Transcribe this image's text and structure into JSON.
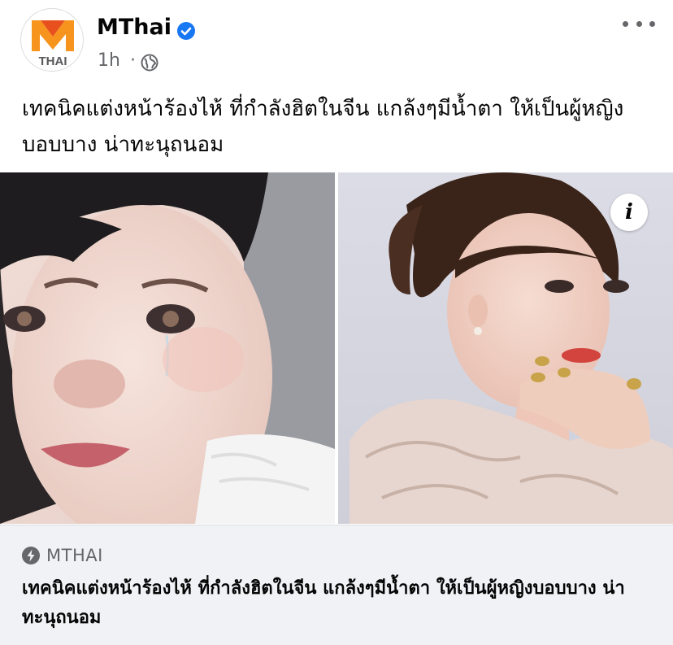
{
  "post": {
    "page_name": "MThai",
    "timestamp": "1h",
    "separator": "·",
    "caption": "เทคนิคแต่งหน้าร้องไห้ ที่กำลังฮิตในจีน แกล้งๆมีน้ำตา ให้เป็นผู้หญิงบอบบาง น่าทะนุถนอม",
    "avatar_logo_text": "THAI",
    "icons": {
      "verified": "verified-badge-icon",
      "privacy": "globe-icon",
      "more": "more-options-icon",
      "info": "info-icon",
      "source": "bolt-icon"
    }
  },
  "media": {
    "info_label": "i"
  },
  "link": {
    "source": "MTHAI",
    "title": "เทคนิคแต่งหน้าร้องไห้ ที่กำลังฮิตในจีน แกล้งๆมีน้ำตา ให้เป็นผู้หญิงบอบบาง น่าทะนุถนอม"
  },
  "colors": {
    "brand_orange": "#f7941d",
    "verified_blue": "#1877f2",
    "secondary_text": "#65676b",
    "card_bg": "#f0f2f5"
  }
}
